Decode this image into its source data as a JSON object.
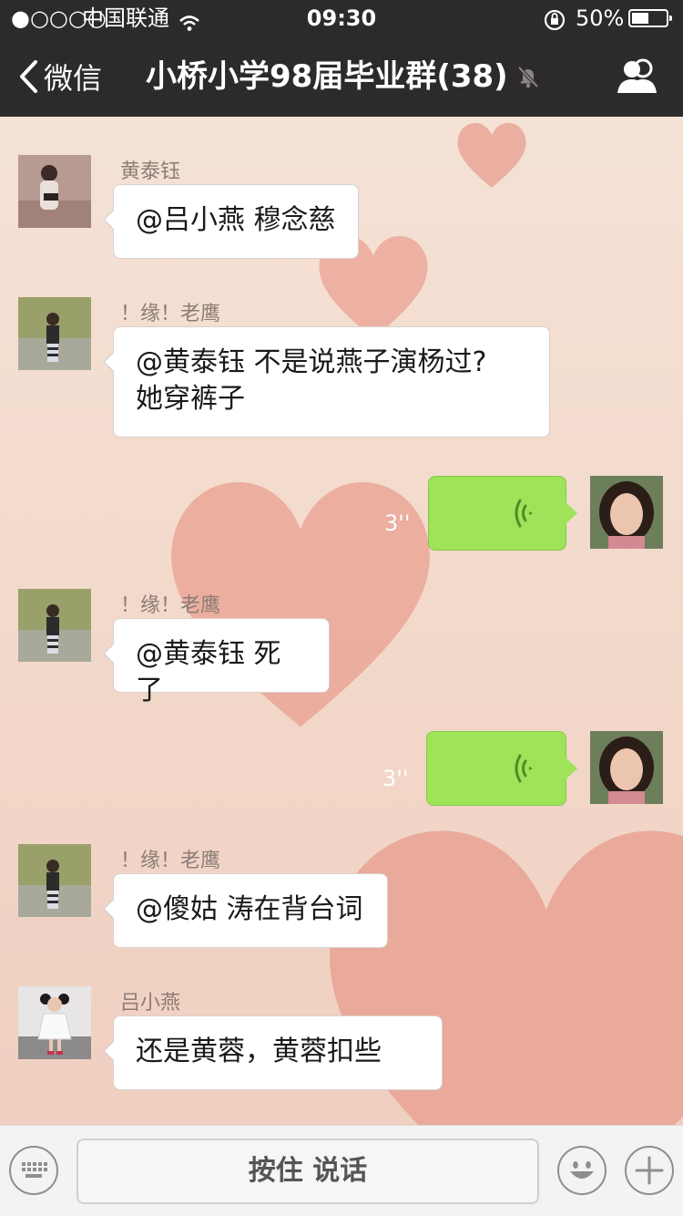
{
  "status_bar": {
    "signal": "●○○○○",
    "carrier": "中国联通",
    "time": "09:30",
    "battery_percent": "50%",
    "battery_level": 0.5
  },
  "nav": {
    "back_label": "微信",
    "title": "小桥小学98届毕业群(38)"
  },
  "messages": [
    {
      "sender": "黄泰钰",
      "lines": [
        "@吕小燕 穆念慈"
      ]
    },
    {
      "sender": "！缘！老鹰",
      "lines": [
        "@黄泰钰 不是说燕子演杨过?",
        "她穿裤子"
      ]
    },
    {
      "duration": "3''"
    },
    {
      "sender": "！缘！老鹰",
      "lines": [
        "@黄泰钰 死了"
      ]
    },
    {
      "duration": "3''"
    },
    {
      "sender": "！缘！老鹰",
      "lines": [
        "@傻姑 涛在背台词"
      ]
    },
    {
      "sender": "吕小燕",
      "lines": [
        "还是黄蓉，黄蓉扣些"
      ]
    }
  ],
  "input_bar": {
    "hold_to_talk_label": "按住 说话"
  },
  "icons": {
    "back": "chevron-left-icon",
    "mute": "bell-slash-icon",
    "members": "group-icon",
    "keyboard": "keyboard-icon",
    "emoji": "smiley-icon",
    "add": "plus-icon",
    "voice_wave": "voice-wave-icon",
    "wifi": "wifi-icon",
    "rotation_lock": "rotation-lock-icon"
  },
  "colors": {
    "nav_bar": "#2d2a2b",
    "voice_bubble": "#9fe358",
    "text_bubble": "#ffffff",
    "wallpaper_heart": "#e9a293"
  }
}
